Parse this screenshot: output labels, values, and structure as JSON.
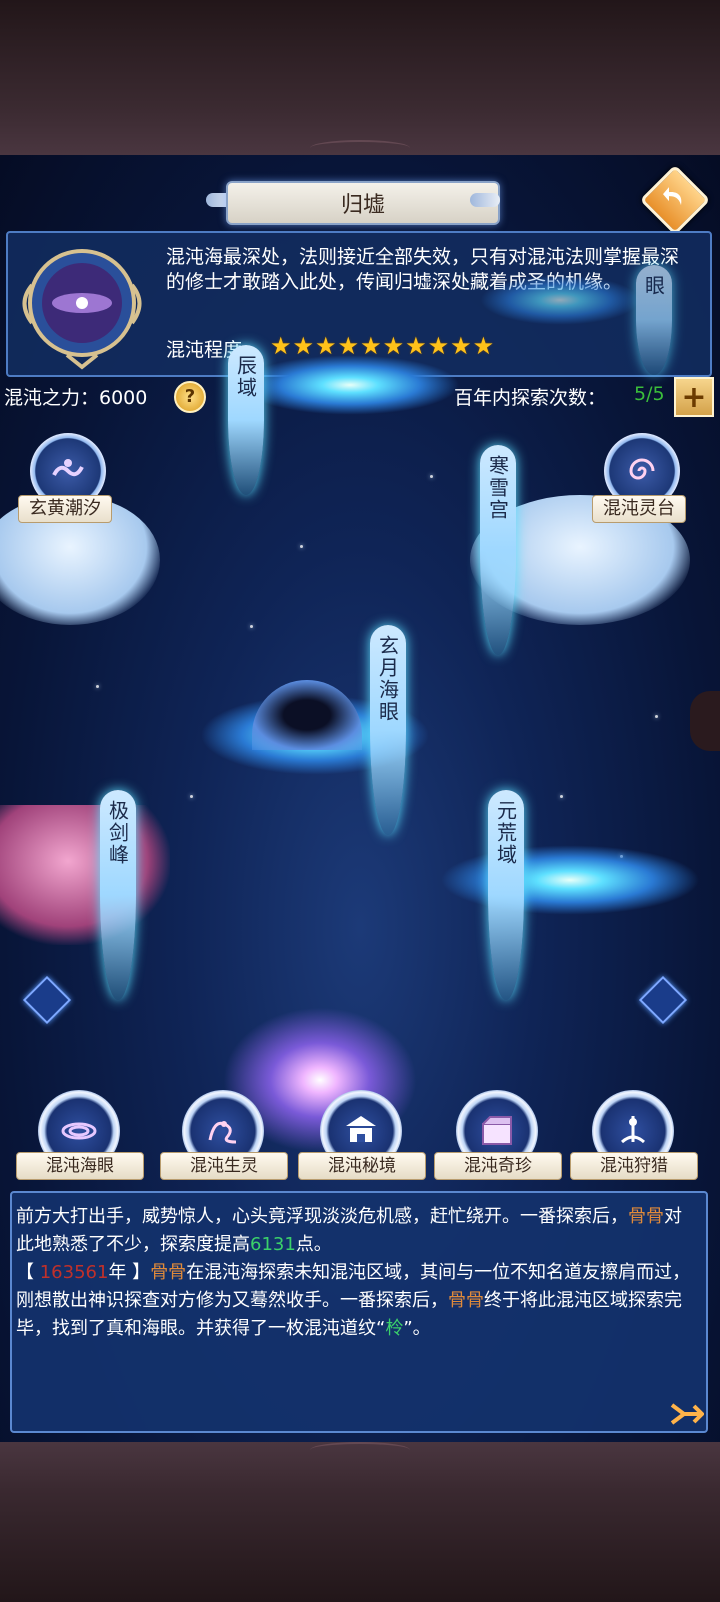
{
  "title": "归墟",
  "info": {
    "description": "混沌海最深处，法则接近全部失效，只有对混沌法则掌握最深的修士才敢踏入此处，传闻归墟深处藏着成圣的机缘。",
    "chaos_level_label": "混沌程度:",
    "chaos_level_stars": 10
  },
  "status": {
    "power_label": "混沌之力：6000",
    "help": "?",
    "explore_label": "百年内探索次数：",
    "explore_count": "5/5",
    "plus": "+"
  },
  "locations": {
    "chen_yu": "辰域",
    "hai_yan_top": "眼",
    "xuan_huang": "玄黄潮汐",
    "ling_tai": "混沌灵台",
    "han_xue": "寒雪宫",
    "xuan_yue": "玄月海眼",
    "ji_jian": "极剑峰",
    "yuan_huang": "元荒域"
  },
  "bottom_buttons": [
    {
      "label": "混沌海眼"
    },
    {
      "label": "混沌生灵"
    },
    {
      "label": "混沌秘境"
    },
    {
      "label": "混沌奇珍"
    },
    {
      "label": "混沌狩猎"
    }
  ],
  "log": {
    "p1": "前方大打出手，威势惊人，心头竟浮现淡淡危机感，赶忙绕开。一番探索后，",
    "name1": "骨骨",
    "p2": "对此地熟悉了不少，探索度提高",
    "points": "6131",
    "p3": "点。",
    "bracket_open": "【 ",
    "year": "163561",
    "year_suffix": "年 】",
    "name2": "骨骨",
    "p4": "在混沌海探索未知混沌区域，其间与一位不知名道友擦肩而过，刚想散出神识探查对方修为又蓦然收手。一番探索后，",
    "name3": "骨骨",
    "p5": "终于将此混沌区域探索完毕，找到了真和海眼。并获得了一枚混沌道纹“",
    "item": "柃",
    "p6": "”。"
  },
  "colors": {
    "accent_gold": "#ffc21a",
    "name_orange": "#e08a3a",
    "value_green": "#3bd06a",
    "year_red": "#c0302a",
    "panel_blue": "#14326c"
  }
}
